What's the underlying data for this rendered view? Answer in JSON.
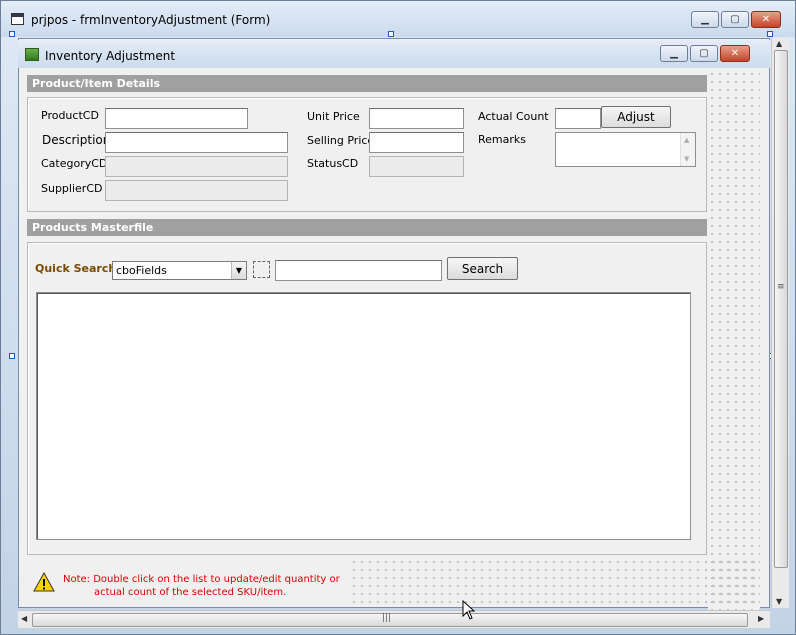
{
  "window": {
    "title": "prjpos - frmInventoryAdjustment (Form)"
  },
  "form": {
    "title": "Inventory Adjustment"
  },
  "details": {
    "header": "Product/Item Details",
    "product_cd_label": "ProductCD",
    "description_label": "Description",
    "category_cd_label": "CategoryCD",
    "supplier_cd_label": "SupplierCD",
    "unit_price_label": "Unit Price",
    "selling_price_label": "Selling Price",
    "status_cd_label": "StatusCD",
    "actual_count_label": "Actual Count",
    "remarks_label": "Remarks",
    "adjust_button": "Adjust"
  },
  "masterfile": {
    "header": "Products Masterfile",
    "quick_search_label": "Quick Search:",
    "field_select_value": "cboFields",
    "search_button": "Search"
  },
  "note": {
    "line1": "Note: Double click on the list to update/edit quantity or",
    "line2": "actual count of  the selected SKU/item."
  },
  "colors": {
    "section_header": "#a0a0a0",
    "note_text": "#e00000",
    "quick_search": "#7a4a00"
  },
  "icons": [
    "form-icon",
    "warning-icon",
    "minimize-icon",
    "maximize-icon",
    "close-icon"
  ]
}
